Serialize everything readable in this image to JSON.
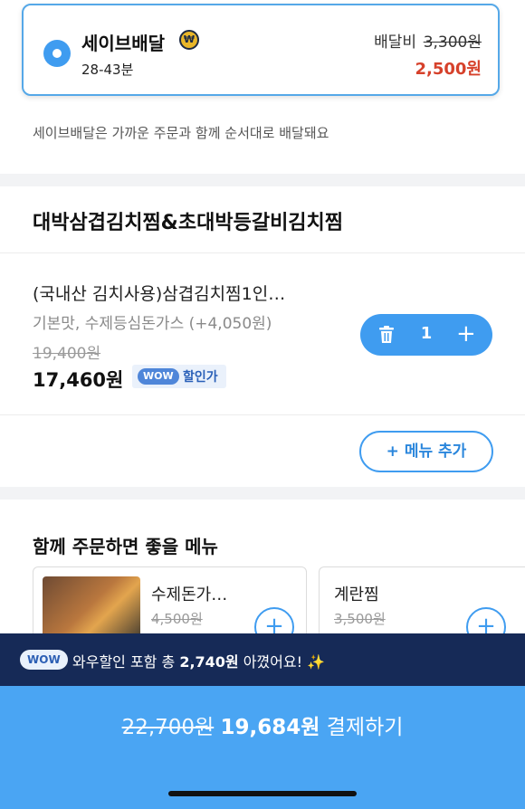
{
  "delivery": {
    "option_title": "세이브배달",
    "badge_icon": "won-coin-icon",
    "eta": "28-43분",
    "fee_label": "배달비",
    "fee_original": "3,300원",
    "fee_discounted": "2,500원",
    "notice": "세이브배달은 가까운 주문과 함께 순서대로 배달돼요"
  },
  "store": {
    "name": "대박삼겹김치찜&초대박등갈비김치찜"
  },
  "cart_item": {
    "name": "(국내산 김치사용)삼겹김치찜1인…",
    "options": "기본맛, 수제등심돈가스 (+4,050원)",
    "original_price": "19,400원",
    "price": "17,460원",
    "wow_label": "WOW",
    "wow_text": "할인가",
    "quantity": "1"
  },
  "add_menu_label": "+ 메뉴 추가",
  "recommend": {
    "title": "함께 주문하면 좋을 메뉴",
    "items": [
      {
        "name": "수제돈가…",
        "original_price": "4,500원"
      },
      {
        "name": "계란찜",
        "original_price": "3,500원"
      }
    ]
  },
  "savings": {
    "wow_label": "WOW",
    "prefix": "와우할인 포함 총 ",
    "amount": "2,740원",
    "suffix": " 아꼈어요! ",
    "emoji": "✨"
  },
  "checkout": {
    "original_total": "22,700원",
    "total": "19,684원",
    "action": "결제하기"
  },
  "colors": {
    "accent": "#3f9cf0",
    "discount_red": "#d6412b",
    "savings_bar": "#162a57",
    "pay_area": "#4aa5f3"
  }
}
